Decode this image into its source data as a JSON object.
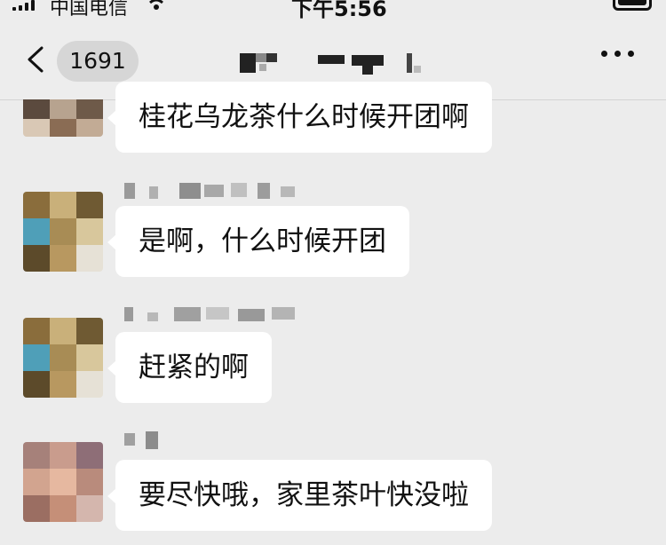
{
  "status_bar": {
    "carrier": "中国电信",
    "time": "下午5:56"
  },
  "nav": {
    "unread_count": "1691"
  },
  "messages": [
    {
      "text": "桂花乌龙茶什么时候开团啊"
    },
    {
      "text": "是啊，什么时候开团"
    },
    {
      "text": "赶紧的啊"
    },
    {
      "text": "要尽快哦，家里茶叶快没啦"
    }
  ],
  "colors": {
    "background": "#ececec",
    "bubble": "#ffffff",
    "badge": "#d6d6d6"
  },
  "icons": [
    "signal-icon",
    "wifi-icon",
    "battery-icon",
    "back-chevron-icon",
    "more-icon"
  ]
}
